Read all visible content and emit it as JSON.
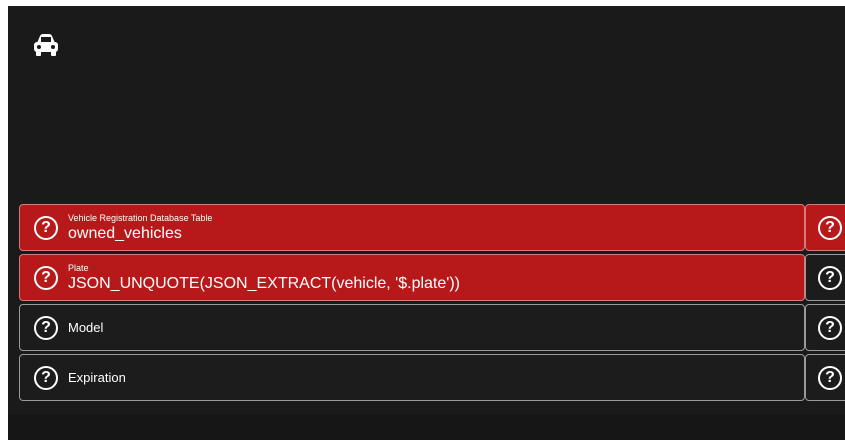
{
  "header": {
    "icon": "car-icon"
  },
  "fields": [
    {
      "label": "Vehicle Registration Database Table",
      "value": "owned_vehicles",
      "state": "error",
      "icon": "help-circle-icon"
    },
    {
      "label": "Plate",
      "value": "JSON_UNQUOTE(JSON_EXTRACT(vehicle, '$.plate'))",
      "state": "error",
      "icon": "help-circle-icon"
    },
    {
      "label": "Model",
      "state": "default",
      "icon": "help-circle-icon"
    },
    {
      "label": "Expiration",
      "state": "default",
      "icon": "help-circle-icon"
    }
  ],
  "help_glyph": "?",
  "colors": {
    "error_bg": "#b7191b",
    "default_bg": "#1c1c1c",
    "page_bg": "#1a1a1a"
  }
}
